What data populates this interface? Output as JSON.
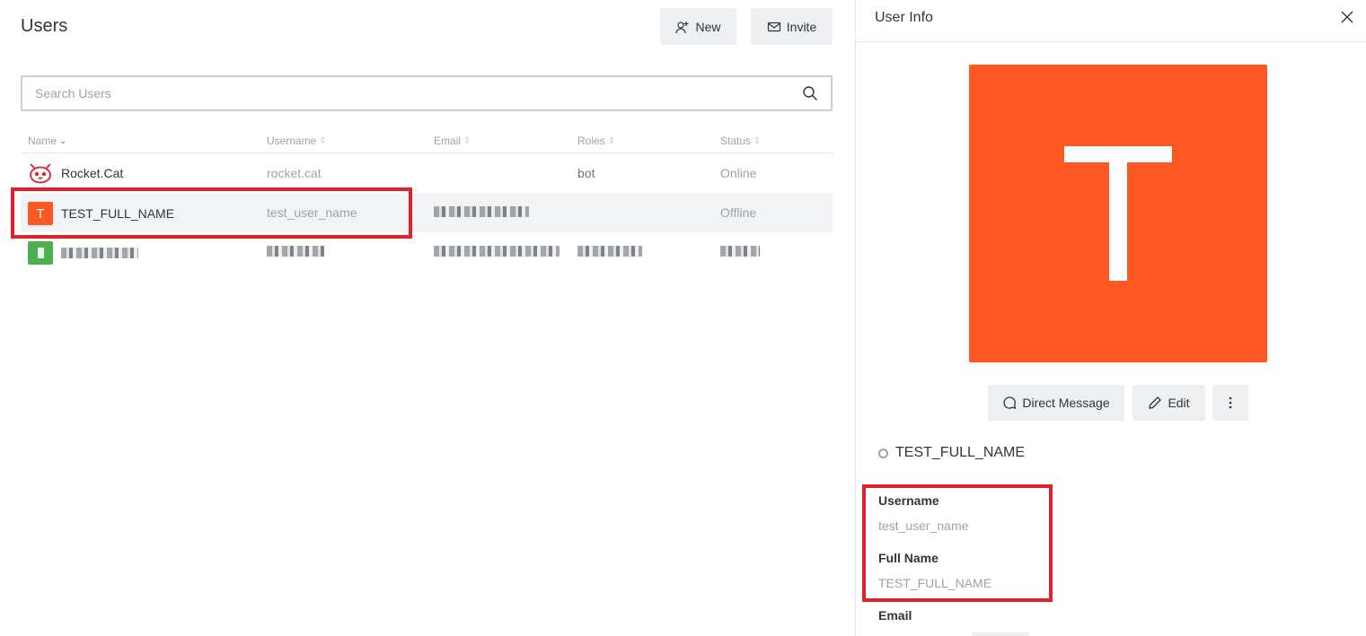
{
  "page": {
    "title": "Users"
  },
  "toolbar": {
    "new_label": "New",
    "invite_label": "Invite"
  },
  "search": {
    "placeholder": "Search Users",
    "value": ""
  },
  "table": {
    "headers": {
      "name": "Name",
      "username": "Username",
      "email": "Email",
      "roles": "Roles",
      "status": "Status"
    },
    "rows": [
      {
        "name": "Rocket.Cat",
        "username": "rocket.cat",
        "email": "",
        "roles": "bot",
        "status": "Online",
        "avatar": "cat-icon"
      },
      {
        "name": "TEST_FULL_NAME",
        "username": "test_user_name",
        "email": "",
        "roles": "",
        "status": "Offline",
        "avatar_letter": "T",
        "avatar_color": "#ff5722"
      },
      {
        "name": "",
        "username": "",
        "email": "",
        "roles": "",
        "status": "",
        "avatar_color": "#4caf50"
      }
    ]
  },
  "user_info": {
    "title": "User Info",
    "avatar_letter": "T",
    "avatar_color": "#ff5722",
    "direct_message_label": "Direct Message",
    "edit_label": "Edit",
    "display_name": "TEST_FULL_NAME",
    "username_label": "Username",
    "username_value": "test_user_name",
    "fullname_label": "Full Name",
    "fullname_value": "TEST_FULL_NAME",
    "email_label": "Email"
  },
  "colors": {
    "highlight": "#e0202b",
    "accent_avatar": "#ff5722",
    "button_bg": "#eeeff1"
  }
}
